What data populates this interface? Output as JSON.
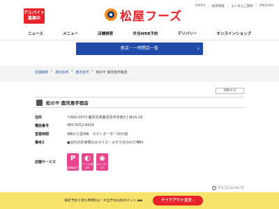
{
  "header": {
    "recruit_badge": "アルバイト\n募集中",
    "brand": "松屋フーズ",
    "top_links": [
      "SHIRO",
      "採用情報",
      "よくあるご質問",
      "ENGLISH"
    ]
  },
  "nav": {
    "items": [
      "ニュース",
      "メニュー",
      "店舗検索",
      "弁当WEB予約",
      "デリバリー",
      "オンラインショップ"
    ]
  },
  "banner": {
    "label": "新店・一時閉店一覧",
    "arrow": "›"
  },
  "breadcrumb": {
    "items": [
      "店舗検索",
      "鹿児島県",
      "鹿児島市",
      "松のや 鹿児島宇宿店"
    ],
    "sep": ">"
  },
  "print_button": "印刷する",
  "store": {
    "name": "松のや 鹿児島宇宿店"
  },
  "info": {
    "rows": [
      {
        "label": "住所",
        "value": "〒890-0073 鹿児島県鹿児島市宇宿2丁目24-18"
      },
      {
        "label": "電話番号",
        "value": "080-5052-8429"
      },
      {
        "label": "営業時間",
        "value": "9時から翌9時　ラストオーダー30分前"
      },
      {
        "label": "備考2",
        "value": "●店内の定食類のみライス・みそ汁おかわり無料"
      }
    ],
    "services_label": "店舗サービス"
  },
  "services": [
    {
      "glyph": "P",
      "caption": "駐車場あり"
    },
    {
      "glyph": "◐",
      "caption": "テーブル席あり"
    },
    {
      "glyph": "◉",
      "caption": "セルフサービス"
    }
  ],
  "icon_link": {
    "label": "アイコンについて",
    "glyph": "?"
  },
  "bottom_bar": {
    "text": "事前予約で待ち時間0分！弁当予約は松弁ネット ▶▶",
    "button": "テイクアウト注文 ›"
  },
  "colors": {
    "brand_red": "#e8232a",
    "nav_blue": "#1f4aa8",
    "service_pink": "#e8458c",
    "bottom_yellow": "#f8e36a"
  }
}
